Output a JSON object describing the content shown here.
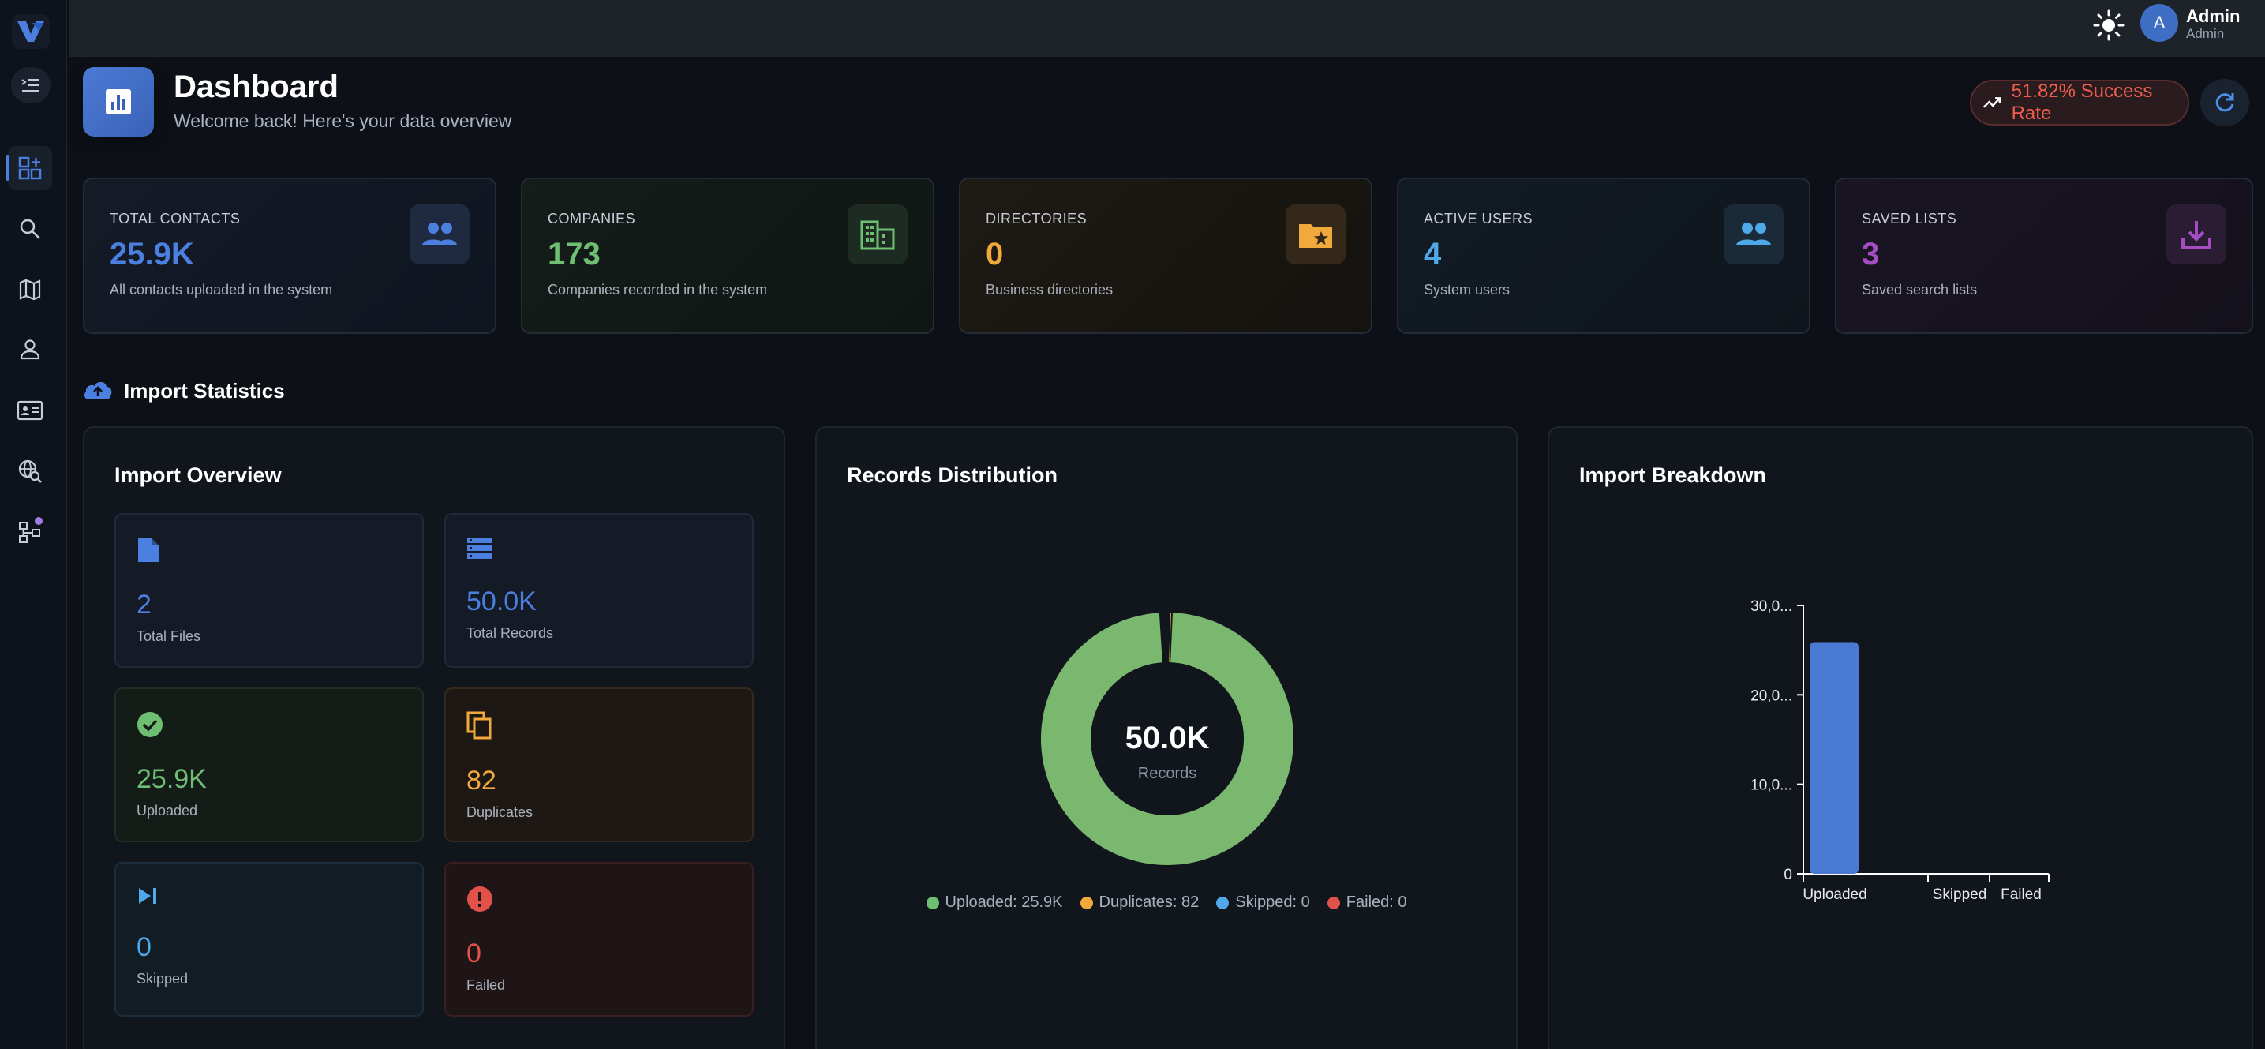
{
  "topbar": {
    "user_initial": "A",
    "user_name": "Admin",
    "user_role": "Admin"
  },
  "header": {
    "title": "Dashboard",
    "subtitle": "Welcome back! Here's your data overview",
    "success_rate": "51.82% Success Rate"
  },
  "stats": [
    {
      "label": "TOTAL CONTACTS",
      "value": "25.9K",
      "desc": "All contacts uploaded in the system",
      "color": "#4b7fe0",
      "icon": "users-icon"
    },
    {
      "label": "COMPANIES",
      "value": "173",
      "desc": "Companies recorded in the system",
      "color": "#6fbf73",
      "icon": "building-icon"
    },
    {
      "label": "DIRECTORIES",
      "value": "0",
      "desc": "Business directories",
      "color": "#f2a93b",
      "icon": "folder-star-icon"
    },
    {
      "label": "ACTIVE USERS",
      "value": "4",
      "desc": "System users",
      "color": "#4fa8e8",
      "icon": "users-icon"
    },
    {
      "label": "SAVED LISTS",
      "value": "3",
      "desc": "Saved search lists",
      "color": "#a54ec4",
      "icon": "download-icon"
    }
  ],
  "section": {
    "title": "Import Statistics"
  },
  "overview": {
    "title": "Import Overview",
    "items": [
      {
        "value": "2",
        "label": "Total Files",
        "color": "#4b7fe0"
      },
      {
        "value": "50.0K",
        "label": "Total Records",
        "color": "#4b7fe0"
      },
      {
        "value": "25.9K",
        "label": "Uploaded",
        "color": "#6fbf73"
      },
      {
        "value": "82",
        "label": "Duplicates",
        "color": "#f2a93b"
      },
      {
        "value": "0",
        "label": "Skipped",
        "color": "#4fa8e8"
      },
      {
        "value": "0",
        "label": "Failed",
        "color": "#e0524a"
      }
    ]
  },
  "distribution": {
    "title": "Records Distribution",
    "center_value": "50.0K",
    "center_label": "Records",
    "legend": [
      {
        "text": "Uploaded: 25.9K",
        "color": "#6fbf73"
      },
      {
        "text": "Duplicates: 82",
        "color": "#f2a93b"
      },
      {
        "text": "Skipped: 0",
        "color": "#4fa8e8"
      },
      {
        "text": "Failed: 0",
        "color": "#e0524a"
      }
    ]
  },
  "breakdown": {
    "title": "Import Breakdown"
  },
  "chart_data": [
    {
      "type": "pie",
      "title": "",
      "labels": [
        "Uploaded",
        "Duplicates",
        "Skipped",
        "Failed"
      ],
      "values": [
        25900,
        82,
        0,
        0
      ],
      "colors": [
        "#7ab86f",
        "#f2a93b",
        "#4fa8e8",
        "#e0524a"
      ],
      "hole": true
    },
    {
      "type": "bar",
      "title": "",
      "categories": [
        "Uploaded",
        "Skipped",
        "Failed"
      ],
      "values": [
        25900,
        0,
        0
      ],
      "ylim": [
        0,
        30000
      ],
      "ytick_labels": [
        "0",
        "10,0...",
        "20,0...",
        "30,0..."
      ],
      "color": "#4b7ad4"
    }
  ]
}
